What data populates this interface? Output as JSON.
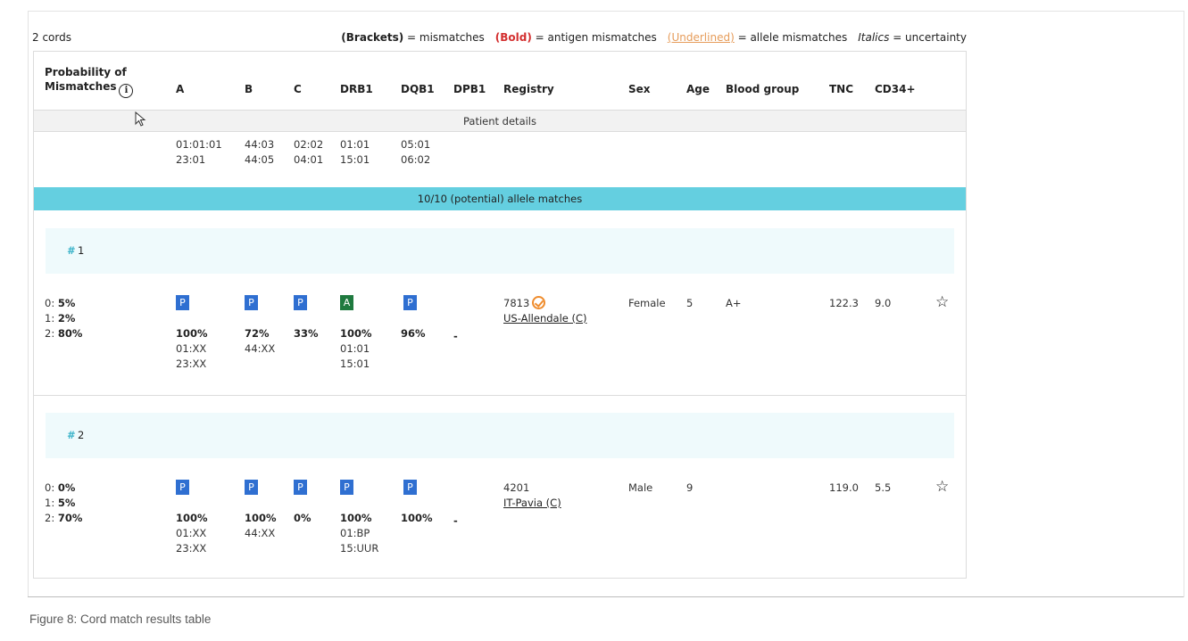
{
  "header": {
    "count": "2 cords",
    "legend": {
      "brackets_key": "(Brackets)",
      "brackets_desc": " = mismatches",
      "bold_key": "(Bold)",
      "bold_desc": " = antigen mismatches",
      "underlined_key": "(Underlined)",
      "underlined_desc": " = allele mismatches",
      "italics_key": "Italics",
      "italics_desc": " = uncertainty"
    }
  },
  "columns": {
    "prob_line1": "Probability of",
    "prob_line2": "Mismatches",
    "a": "A",
    "b": "B",
    "c": "C",
    "drb1": "DRB1",
    "dqb1": "DQB1",
    "dpb1": "DPB1",
    "registry": "Registry",
    "sex": "Sex",
    "age": "Age",
    "blood_group": "Blood group",
    "tnc": "TNC",
    "cd34": "CD34+"
  },
  "patient": {
    "band_label": "Patient details",
    "a1": "01:01:01",
    "a2": "23:01",
    "b1": "44:03",
    "b2": "44:05",
    "c1": "02:02",
    "c2": "04:01",
    "drb1_1": "01:01",
    "drb1_2": "15:01",
    "dqb1_1": "05:01",
    "dqb1_2": "06:02"
  },
  "match_band": "10/10 (potential) allele matches",
  "results": [
    {
      "hash": "#",
      "number": "1",
      "prob": [
        {
          "label": "0: ",
          "value": "5%"
        },
        {
          "label": "1: ",
          "value": "2%"
        },
        {
          "label": "2: ",
          "value": "80%"
        }
      ],
      "a": {
        "badge": "P",
        "pct": "100%",
        "t1": "01:XX",
        "t2": "23:XX"
      },
      "b": {
        "badge": "P",
        "pct": "72%",
        "t1": "44:XX"
      },
      "c": {
        "badge": "P",
        "pct": "33%"
      },
      "drb1": {
        "badge": "A",
        "pct": "100%",
        "t1": "01:01",
        "t2": "15:01"
      },
      "dqb1": {
        "badge": "P",
        "pct": "96%"
      },
      "dpb1": "-",
      "registry_id": "7813",
      "registry_name": "US-Allendale (C)",
      "sex": "Female",
      "age": "5",
      "blood_group": "A+",
      "tnc": "122.3",
      "cd34": "9.0"
    },
    {
      "hash": "#",
      "number": "2",
      "prob": [
        {
          "label": "0: ",
          "value": "0%"
        },
        {
          "label": "1: ",
          "value": "5%"
        },
        {
          "label": "2: ",
          "value": "70%"
        }
      ],
      "a": {
        "badge": "P",
        "pct": "100%",
        "t1": "01:XX",
        "t2": "23:XX"
      },
      "b": {
        "badge": "P",
        "pct": "100%",
        "t1": "44:XX"
      },
      "c": {
        "badge": "P",
        "pct": "0%"
      },
      "drb1": {
        "badge": "P",
        "pct": "100%",
        "t1": "01:BP",
        "t2": "15:UUR"
      },
      "dqb1": {
        "badge": "P",
        "pct": "100%"
      },
      "dpb1": "-",
      "registry_id": "4201",
      "registry_name": "IT-Pavia (C)",
      "sex": "Male",
      "age": "9",
      "tnc": "119.0",
      "cd34": "5.5"
    }
  ],
  "caption": "Figure 8: Cord match results table"
}
